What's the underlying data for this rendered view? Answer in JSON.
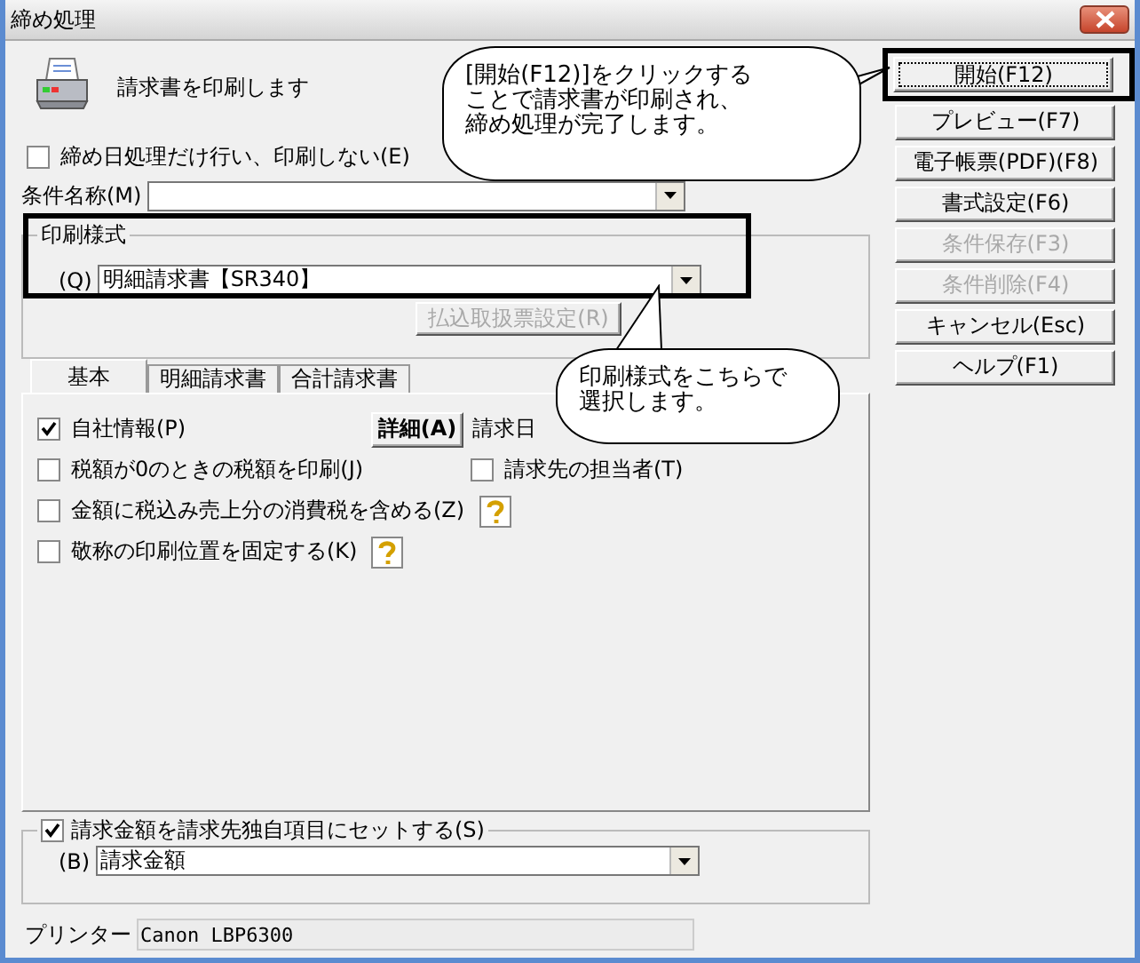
{
  "window": {
    "title": "締め処理"
  },
  "header": {
    "text": "請求書を印刷します"
  },
  "skip_printing": {
    "label": "締め日処理だけ行い、印刷しない(E)",
    "checked": false
  },
  "condition_name": {
    "label": "条件名称(M)"
  },
  "print_style": {
    "title": "印刷様式",
    "field_label": "(Q)",
    "value": "明細請求書【SR340】",
    "highlighted": true,
    "button": {
      "label": "払込取扱票設定(R)",
      "disabled": true
    }
  },
  "tabs": [
    {
      "label": "基本",
      "selected": true
    },
    {
      "label": "明細請求書",
      "selected": false
    },
    {
      "label": "合計請求書",
      "selected": false
    }
  ],
  "rows": [
    {
      "items": [
        {
          "kind": "checkbox",
          "label": "自社情報(P)",
          "checked": true
        },
        {
          "kind": "button",
          "label": "詳細(A)"
        },
        {
          "kind": "text",
          "label": "請求日"
        }
      ]
    },
    {
      "items": [
        {
          "kind": "checkbox",
          "label": "税額が0のときの税額を印刷(J)",
          "checked": false
        },
        {
          "kind": "checkbox",
          "label": "請求先の担当者(T)",
          "checked": false
        }
      ]
    },
    {
      "items": [
        {
          "kind": "checkbox",
          "label": "金額に税込み売上分の消費税を含める(Z)",
          "checked": false
        },
        {
          "kind": "help"
        }
      ]
    },
    {
      "items": [
        {
          "kind": "checkbox",
          "label": "敬称の印刷位置を固定する(K)",
          "checked": false
        },
        {
          "kind": "help"
        }
      ]
    }
  ],
  "custom_field": {
    "label": "請求金額を請求先独自項目にセットする(S)",
    "checked": true,
    "field_label": "(B)",
    "value": "請求金額"
  },
  "printer": {
    "label": "プリンター",
    "value": "Canon LBP6300"
  },
  "buttons": [
    {
      "label": "開始(F12)",
      "disabled": false,
      "highlighted": true
    },
    {
      "label": "プレビュー(F7)",
      "disabled": false,
      "highlighted": false
    },
    {
      "label": "電子帳票(PDF)(F8)",
      "disabled": false,
      "highlighted": false
    },
    {
      "label": "書式設定(F6)",
      "disabled": false,
      "highlighted": false
    },
    {
      "label": "条件保存(F3)",
      "disabled": true,
      "highlighted": false
    },
    {
      "label": "条件削除(F4)",
      "disabled": true,
      "highlighted": false
    },
    {
      "label": "キャンセル(Esc)",
      "disabled": false,
      "highlighted": false
    },
    {
      "label": "ヘルプ(F1)",
      "disabled": false,
      "highlighted": false
    }
  ],
  "callouts": [
    {
      "lines": [
        "[開始(F12)]をクリックする",
        "ことで請求書が印刷され、",
        "締め処理が完了します。"
      ]
    },
    {
      "lines": [
        "印刷様式をこちらで",
        "選択します。"
      ]
    }
  ]
}
